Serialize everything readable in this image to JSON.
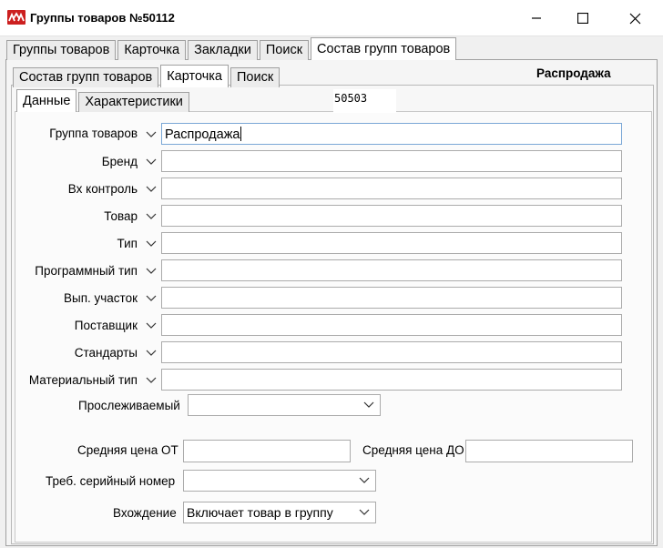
{
  "window": {
    "title": "Группы товаров №50112"
  },
  "tabs_level1": [
    {
      "label": "Группы товаров",
      "active": false
    },
    {
      "label": "Карточка",
      "active": false
    },
    {
      "label": "Закладки",
      "active": false
    },
    {
      "label": "Поиск",
      "active": false
    },
    {
      "label": "Состав групп товаров",
      "active": true
    }
  ],
  "tabs_level2": [
    {
      "label": "Состав групп товаров",
      "active": false
    },
    {
      "label": "Карточка",
      "active": true
    },
    {
      "label": "Поиск",
      "active": false
    }
  ],
  "tabs_level3": [
    {
      "label": "Данные",
      "active": true
    },
    {
      "label": "Характеристики",
      "active": false
    }
  ],
  "header": {
    "group_name": "Распродажа",
    "code": "50503"
  },
  "fields": [
    {
      "label": "Группа товаров",
      "value": "Распродажа"
    },
    {
      "label": "Бренд",
      "value": ""
    },
    {
      "label": "Вх контроль",
      "value": ""
    },
    {
      "label": "Товар",
      "value": ""
    },
    {
      "label": "Тип",
      "value": ""
    },
    {
      "label": "Программный тип",
      "value": ""
    },
    {
      "label": "Вып. участок",
      "value": ""
    },
    {
      "label": "Поставщик",
      "value": ""
    },
    {
      "label": "Стандарты",
      "value": ""
    },
    {
      "label": "Материальный тип",
      "value": ""
    }
  ],
  "tracked": {
    "label": "Прослеживаемый",
    "value": ""
  },
  "price": {
    "from_label": "Средняя цена ОТ",
    "from_value": "",
    "to_label": "Средняя цена ДО",
    "to_value": ""
  },
  "serial": {
    "label": "Треб. серийный номер",
    "value": ""
  },
  "inclusion": {
    "label": "Вхождение",
    "value": "Включает товар в группу"
  },
  "icons": {
    "app": "app-logo-icon",
    "minimize": "minimize-icon",
    "maximize": "maximize-icon",
    "close": "close-icon",
    "dropdown": "chevron-down-icon"
  },
  "colors": {
    "app_icon": "#cc1f1f",
    "focus_border": "#7aa7d6"
  }
}
